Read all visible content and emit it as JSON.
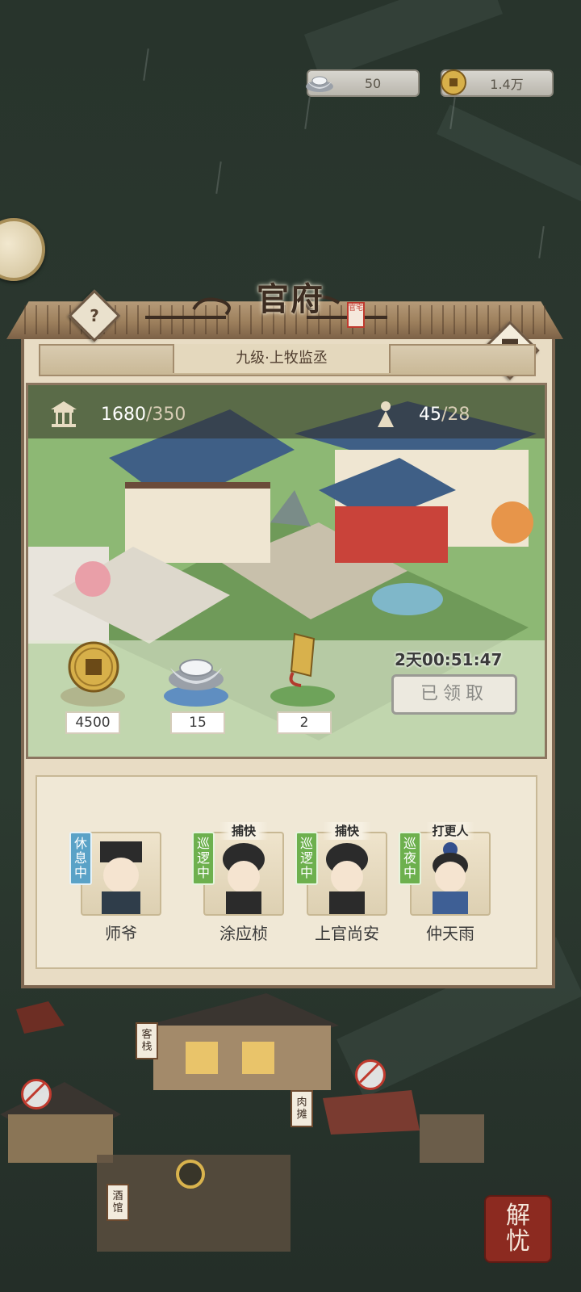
{
  "currency": {
    "silver": {
      "icon": "silver-ingot-icon",
      "value": "50"
    },
    "coin": {
      "icon": "copper-coin-icon",
      "value": "1.4万"
    }
  },
  "panel": {
    "title": "官府",
    "seal_text": "官宅",
    "rank": "九级·上牧监丞",
    "prosperity": {
      "icon": "pavilion-icon",
      "current": "1680",
      "max": "/350"
    },
    "population": {
      "icon": "villager-icon",
      "current": "45",
      "max": "/28"
    },
    "rewards": [
      {
        "icon": "copper-coin-icon",
        "amount": "4500"
      },
      {
        "icon": "silver-ingot-icon",
        "amount": "15"
      },
      {
        "icon": "token-plaque-icon",
        "amount": "2"
      }
    ],
    "timer": "2天00:51:47",
    "claim_label": "已领取"
  },
  "staff": [
    {
      "name": "师爷",
      "status": "休息中",
      "role": "",
      "color": "blue"
    },
    {
      "name": "涂应桢",
      "status": "巡逻中",
      "role": "捕快",
      "color": "green"
    },
    {
      "name": "上官尚安",
      "status": "巡逻中",
      "role": "捕快",
      "color": "green"
    },
    {
      "name": "仲天雨",
      "status": "巡夜中",
      "role": "打更人",
      "color": "green"
    }
  ],
  "map_labels": {
    "inn": "客栈",
    "butcher": "肉摊",
    "tavern": "酒馆"
  },
  "corner_button": {
    "line1": "解",
    "line2": "忧"
  },
  "colors": {
    "accent_wood": "#7e6751",
    "panel_bg": "#e8dcc4",
    "status_blue": "#5aa2c7",
    "status_green": "#6db04e"
  }
}
